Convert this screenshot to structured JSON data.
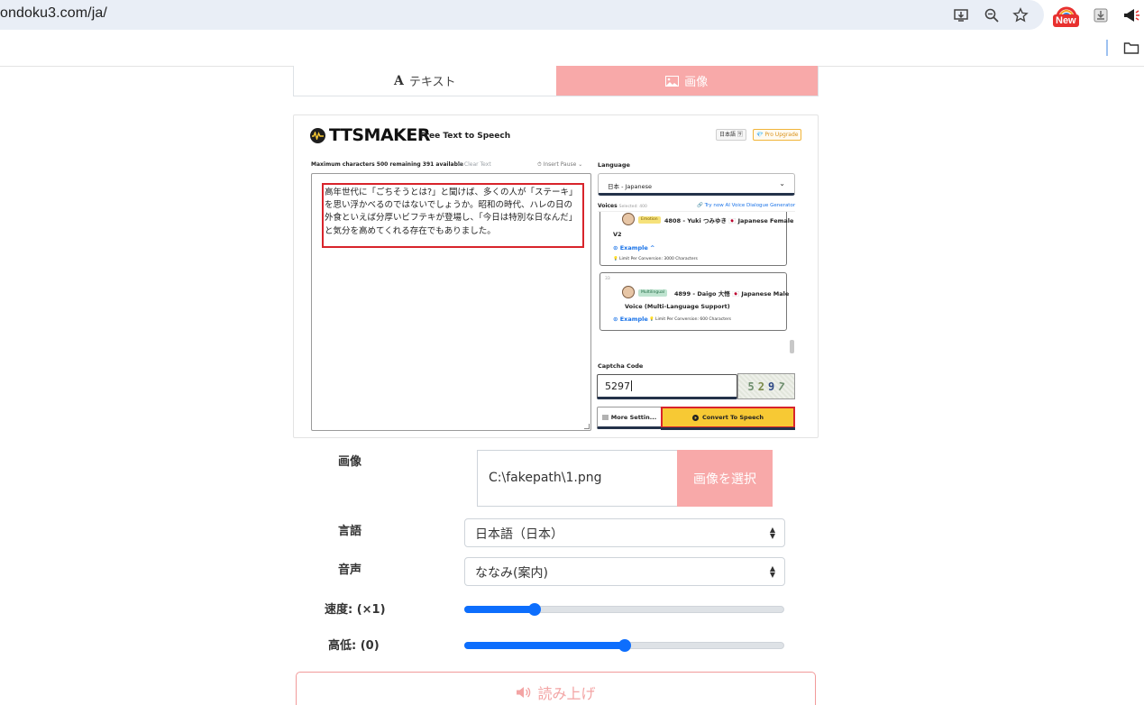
{
  "browser": {
    "url": "ondoku3.com/ja/",
    "new_badge": "New"
  },
  "tabs": {
    "text_glyph": "A",
    "text_label": "テキスト",
    "image_label": "画像"
  },
  "tts_maker": {
    "brand": "TTSMAKER",
    "tagline": "Free Text to Speech",
    "lang_chip": "日本語 🈂",
    "pro_chip": "💎 Pro Upgrade",
    "max_chars": "Maximum characters 500 remaining 391 available",
    "clear_text": "⊘ Clear Text",
    "insert_pause": "⏱ Insert Pause ⌄",
    "text_lines": "高年世代に「ごちそうとは?」と聞けば、多くの人が「ステーキ」\nを思い浮かべるのではないでしょうか。昭和の時代、ハレの日の\n外食といえば分厚いビフテキが登場し、「今日は特別な日なんだ」\nと気分を高めてくれる存在でもありました。",
    "language_label": "Language",
    "language_value": "日本 - Japanese",
    "voices_label": "Voices",
    "voices_selected": "Selected: 400",
    "try_link": "🔗 Try now AI Voice Dialogue Generator",
    "voice1": {
      "chip": "Emotion",
      "name": "4808 - Yuki つみゆき 🇯🇵 Japanese Female",
      "name2": "V2",
      "example": "⊙ Example ^",
      "limit": "💡 Limit Per Conversion: 3000 Characters"
    },
    "voice2": {
      "index": "33",
      "chip": "Multilingual",
      "name": "4899 - Daigo 大悟 🇯🇵 Japanese Male",
      "name2": "Voice (Multi-Language Support)",
      "example": "⊙ Example",
      "limit": "💡 Limit Per Conversion: 600 Characters"
    },
    "captcha_label": "Captcha Code",
    "captcha_value": "5297",
    "captcha_digits": [
      "5",
      "2",
      "9",
      "7"
    ],
    "more_settings": "More Settin...",
    "convert": "Convert To Speech"
  },
  "form": {
    "image_label": "画像",
    "file_path": "C:\\fakepath\\1.png",
    "file_button": "画像を選択",
    "language_label": "言語",
    "language_value": "日本語（日本）",
    "voice_label": "音声",
    "voice_value": "ななみ(案内)",
    "speed_label": "速度: (×1)",
    "speed_fraction": 0.22,
    "pitch_label": "高低: (0)",
    "pitch_fraction": 0.5,
    "read_button": "読み上げ"
  },
  "colors": {
    "accent_pink": "#f8a9a9",
    "slider_blue": "#0d6efd",
    "convert_yellow": "#f7c934",
    "highlight_red": "#d8242b"
  }
}
